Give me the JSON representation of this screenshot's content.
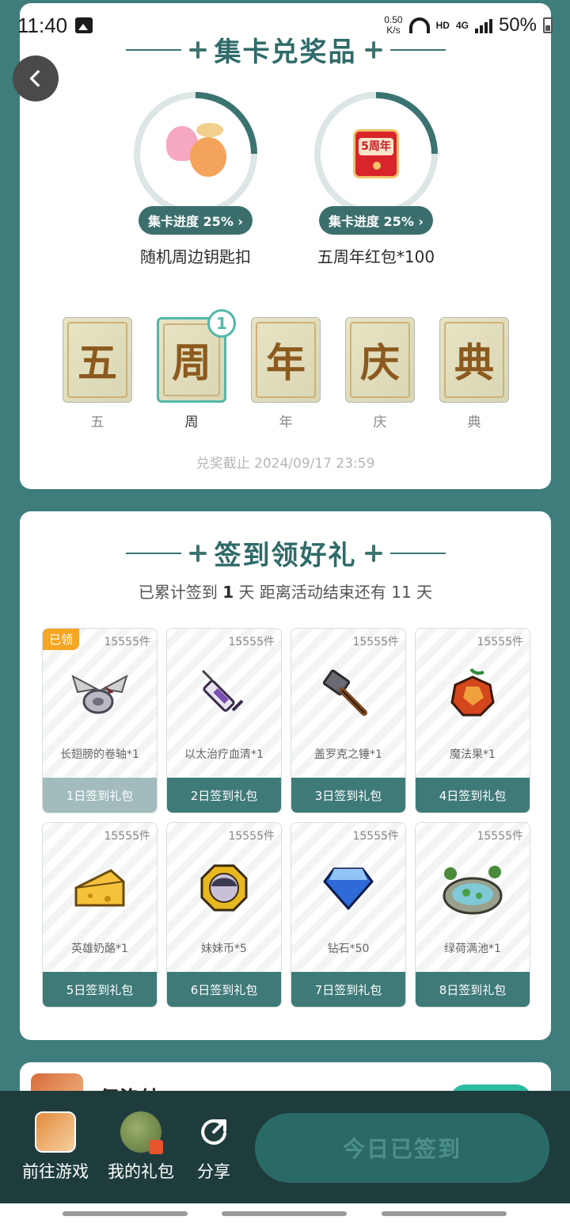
{
  "status_bar": {
    "time": "11:40",
    "net_speed_value": "0.50",
    "net_speed_unit": "K/s",
    "hd": "HD",
    "network": "4G",
    "battery": "50%"
  },
  "collect_card": {
    "title": "集卡兑奖品",
    "prizes": [
      {
        "name": "随机周边钥匙扣",
        "progress_label": "集卡进度 25%",
        "progress": 0.25
      },
      {
        "name": "五周年红包*100",
        "progress_label": "集卡进度 25%",
        "progress": 0.25,
        "art_text": "5周年"
      }
    ],
    "cards": [
      {
        "glyph": "五",
        "label": "五",
        "count": null
      },
      {
        "glyph": "周",
        "label": "周",
        "count": "1"
      },
      {
        "glyph": "年",
        "label": "年",
        "count": null
      },
      {
        "glyph": "庆",
        "label": "庆",
        "count": null
      },
      {
        "glyph": "典",
        "label": "典",
        "count": null
      }
    ],
    "deadline": "兑奖截止 2024/09/17 23:59"
  },
  "checkin": {
    "title": "签到领好礼",
    "summary_prefix": "已累计签到",
    "summary_days": "1",
    "summary_suffix": "天  距离活动结束还有 11 天",
    "claimed_tag": "已领",
    "rewards": [
      {
        "qty": "15555件",
        "name": "长翅膀的卷轴*1",
        "day_label": "1日签到礼包",
        "icon": "winged-scroll-icon",
        "claimed": true
      },
      {
        "qty": "15555件",
        "name": "以太治疗血清*1",
        "day_label": "2日签到礼包",
        "icon": "syringe-icon",
        "claimed": false
      },
      {
        "qty": "15555件",
        "name": "盖罗克之锤*1",
        "day_label": "3日签到礼包",
        "icon": "hammer-icon",
        "claimed": false
      },
      {
        "qty": "15555件",
        "name": "魔法果*1",
        "day_label": "4日签到礼包",
        "icon": "magic-fruit-icon",
        "claimed": false
      },
      {
        "qty": "15555件",
        "name": "英雄奶酪*1",
        "day_label": "5日签到礼包",
        "icon": "cheese-icon",
        "claimed": false
      },
      {
        "qty": "15555件",
        "name": "妹妹币*5",
        "day_label": "6日签到礼包",
        "icon": "coin-icon",
        "claimed": false
      },
      {
        "qty": "15555件",
        "name": "钻石*50",
        "day_label": "7日签到礼包",
        "icon": "diamond-icon",
        "claimed": false
      },
      {
        "qty": "15555件",
        "name": "绿荷满池*1",
        "day_label": "8日签到礼包",
        "icon": "lotus-pond-icon",
        "claimed": false
      }
    ]
  },
  "game_card": {
    "name": "伊洛纳"
  },
  "bottom_bar": {
    "go_game": "前往游戏",
    "my_gifts": "我的礼包",
    "share": "分享",
    "signin_button": "今日已签到"
  },
  "colors": {
    "background": "#3f7c7c",
    "accent": "#3b6f6d",
    "badge": "#53b7a8",
    "claimed_tag": "#f5a623"
  }
}
